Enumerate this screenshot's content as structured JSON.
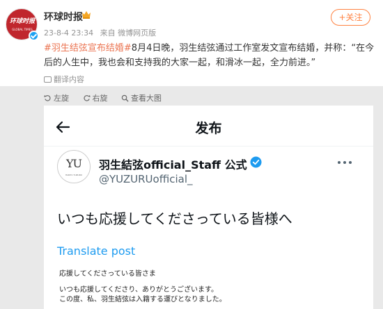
{
  "post": {
    "account_name": "环球时报",
    "avatar_text": "环球时报",
    "avatar_subtext": "GLOBAL TIMES",
    "timestamp": "23-8-4 23:34",
    "source": "来自 微博网页版",
    "follow_label": "+关注",
    "hashtag": "#羽生结弦宣布结婚#",
    "body": "8月4日晚，羽生结弦通过工作室发文宣布结婚，并称：“在今后的人生中，我也会和支持我的大家一起，和滑冰一起，全力前进。”",
    "translate_label": "翻译内容"
  },
  "toolbar": {
    "items": [
      {
        "icon": "rotate-left-icon",
        "label": "左旋"
      },
      {
        "icon": "rotate-right-icon",
        "label": "右旋"
      },
      {
        "icon": "view-original-icon",
        "label": "查看大图"
      }
    ]
  },
  "screenshot": {
    "title": "发布",
    "display_name": "羽生結弦official_Staff 公式",
    "handle": "@YUZURUofficial_",
    "avatar_text": "YU",
    "avatar_subtext": "HANYU YUZURU",
    "tweet_text": "いつも応援してくださっている皆様へ",
    "translate_link": "Translate post",
    "letter_lines": [
      "応援してくださっている皆さま",
      "",
      "いつも応援してくださり、ありがとうございます。",
      "この度、私、羽生結弦は入籍する運びとなりました。"
    ]
  },
  "colors": {
    "hashtag": "#eb7350",
    "follow": "#ff8140",
    "twitter_blue": "#1d9bf0",
    "verified_badge": "#1da1f2",
    "gold_crown": "#f5a623"
  }
}
